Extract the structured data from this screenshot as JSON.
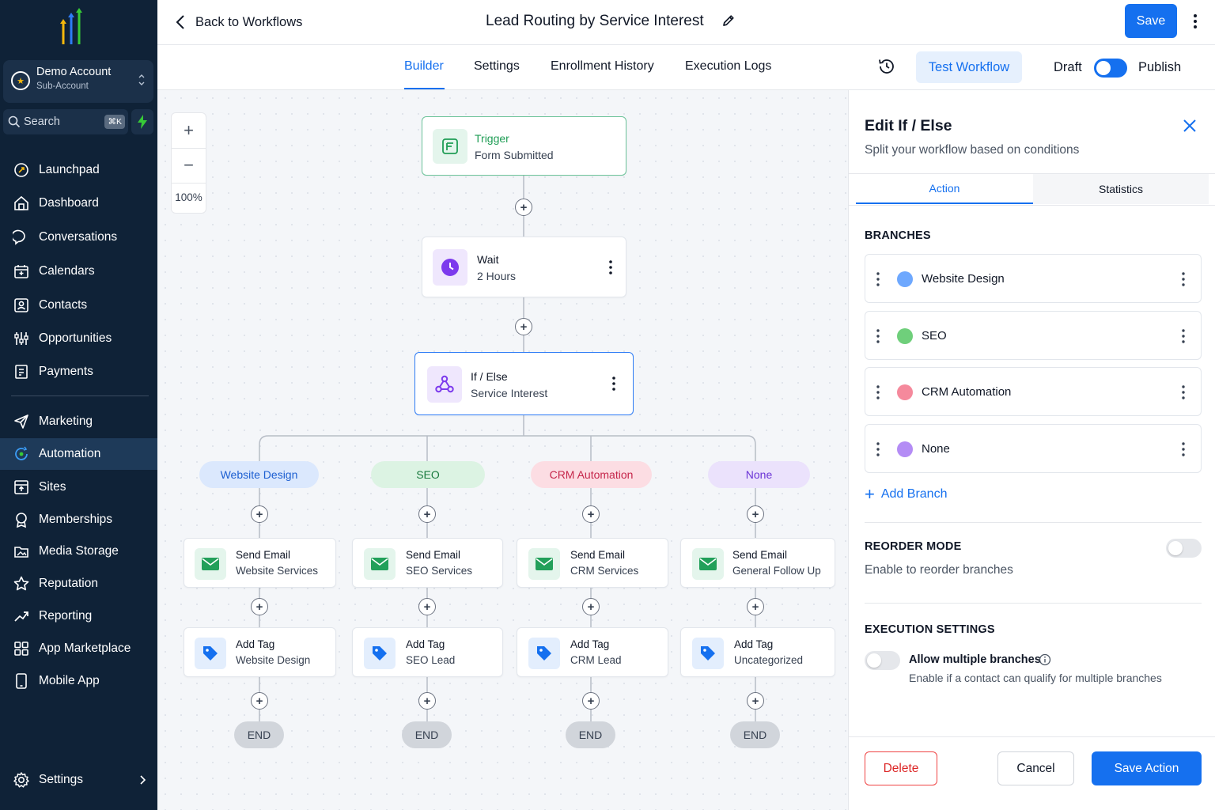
{
  "sidebar": {
    "account": {
      "name": "Demo Account",
      "subtitle": "Sub-Account"
    },
    "search": {
      "label": "Search",
      "shortcut": "⌘K"
    },
    "items": [
      {
        "label": "Launchpad",
        "icon": "launchpad-icon"
      },
      {
        "label": "Dashboard",
        "icon": "dashboard-icon"
      },
      {
        "label": "Conversations",
        "icon": "chat-icon"
      },
      {
        "label": "Calendars",
        "icon": "calendar-icon"
      },
      {
        "label": "Contacts",
        "icon": "contacts-icon"
      },
      {
        "label": "Opportunities",
        "icon": "opportunities-icon"
      },
      {
        "label": "Payments",
        "icon": "payments-icon"
      },
      {
        "label": "Marketing",
        "icon": "send-icon"
      },
      {
        "label": "Automation",
        "icon": "automation-icon",
        "active": true
      },
      {
        "label": "Sites",
        "icon": "sites-icon"
      },
      {
        "label": "Memberships",
        "icon": "memberships-icon"
      },
      {
        "label": "Media Storage",
        "icon": "media-icon"
      },
      {
        "label": "Reputation",
        "icon": "star-icon"
      },
      {
        "label": "Reporting",
        "icon": "reporting-icon"
      },
      {
        "label": "App Marketplace",
        "icon": "apps-icon"
      },
      {
        "label": "Mobile App",
        "icon": "mobile-icon"
      }
    ],
    "settings_label": "Settings"
  },
  "header": {
    "back_label": "Back to Workflows",
    "title": "Lead Routing by Service Interest",
    "save_label": "Save",
    "tabs": [
      {
        "label": "Builder",
        "active": true
      },
      {
        "label": "Settings"
      },
      {
        "label": "Enrollment History"
      },
      {
        "label": "Execution Logs"
      }
    ],
    "test_label": "Test Workflow",
    "draft_label": "Draft",
    "publish_label": "Publish"
  },
  "canvas": {
    "zoom_level": "100%",
    "trigger": {
      "title": "Trigger",
      "subtitle": "Form Submitted"
    },
    "wait": {
      "title": "Wait",
      "subtitle": "2 Hours"
    },
    "ifelse": {
      "title": "If / Else",
      "subtitle": "Service Interest"
    },
    "end_label": "END",
    "branches": [
      {
        "label": "Website Design",
        "email": {
          "title": "Send Email",
          "subtitle": "Website Services"
        },
        "tag": {
          "title": "Add Tag",
          "subtitle": "Website Design"
        }
      },
      {
        "label": "SEO",
        "email": {
          "title": "Send Email",
          "subtitle": "SEO Services"
        },
        "tag": {
          "title": "Add Tag",
          "subtitle": "SEO Lead"
        }
      },
      {
        "label": "CRM Automation",
        "email": {
          "title": "Send Email",
          "subtitle": "CRM Services"
        },
        "tag": {
          "title": "Add Tag",
          "subtitle": "CRM Lead"
        }
      },
      {
        "label": "None",
        "email": {
          "title": "Send Email",
          "subtitle": "General Follow Up"
        },
        "tag": {
          "title": "Add Tag",
          "subtitle": "Uncategorized"
        }
      }
    ]
  },
  "panel": {
    "title": "Edit If / Else",
    "subtitle": "Split your workflow based on conditions",
    "tabs": [
      {
        "label": "Action",
        "active": true
      },
      {
        "label": "Statistics"
      }
    ],
    "branches_heading": "BRANCHES",
    "branches": [
      {
        "label": "Website Design",
        "color": "#6ea8fe"
      },
      {
        "label": "SEO",
        "color": "#6fcf7b"
      },
      {
        "label": "CRM Automation",
        "color": "#f5899c"
      },
      {
        "label": "None",
        "color": "#b48cf5"
      }
    ],
    "add_branch_label": "Add Branch",
    "reorder_heading": "REORDER MODE",
    "reorder_desc": "Enable to reorder branches",
    "execution_heading": "EXECUTION SETTINGS",
    "multi_label": "Allow multiple branches",
    "multi_desc": "Enable if a contact can qualify for multiple branches",
    "delete_label": "Delete",
    "cancel_label": "Cancel",
    "save_action_label": "Save Action"
  },
  "colors": {
    "accent": "#1570ef",
    "sidebar_bg": "#0f2237",
    "pill_website": "#dbe8fd",
    "pill_seo": "#dcf3e3",
    "pill_crm": "#fcdde3",
    "pill_none": "#ebe2fc"
  }
}
